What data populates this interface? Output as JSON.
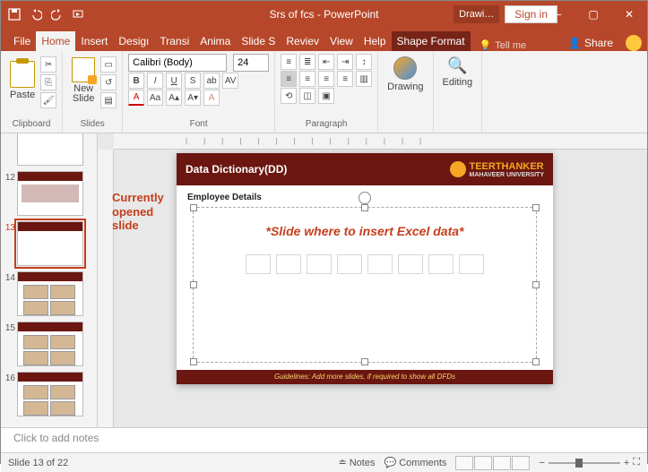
{
  "titlebar": {
    "title": "Srs of fcs - PowerPoint",
    "drawing": "Drawi…",
    "signin": "Sign in"
  },
  "tabs": {
    "file": "File",
    "home": "Home",
    "insert": "Insert",
    "design": "Desigı",
    "transitions": "Transi",
    "animations": "Anima",
    "slideshow": "Slide S",
    "review": "Reviev",
    "view": "View",
    "help": "Help",
    "shapeformat": "Shape Format",
    "tellme": "Tell me",
    "share": "Share"
  },
  "ribbon": {
    "clipboard": "Clipboard",
    "paste": "Paste",
    "slides": "Slides",
    "newslide": "New\nSlide",
    "font": "Font",
    "fontname": "Calibri (Body)",
    "fontsize": "24",
    "paragraph": "Paragraph",
    "drawing": "Drawing",
    "editing": "Editing"
  },
  "thumbs": {
    "n12": "12",
    "n13": "13",
    "n14": "14",
    "n15": "15",
    "n16": "16"
  },
  "annotation": "Currently\nopened\nslide",
  "slide": {
    "header": "Data Dictionary(DD)",
    "logo1": "TEERTHANKER",
    "logo2": "MAHAVEER UNIVERSITY",
    "emp": "Employee Details",
    "insert": "*Slide where to insert Excel data*",
    "footer": "Guidelines: Add more slides, if required to show all DFDs"
  },
  "notes": "Click to add notes",
  "status": {
    "left": "Slide 13 of 22",
    "notes": "Notes",
    "comments": "Comments",
    "zoom": "+"
  }
}
